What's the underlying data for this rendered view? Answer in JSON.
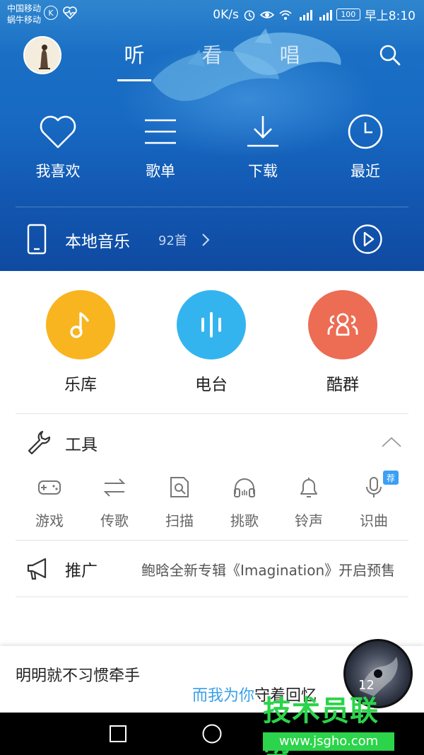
{
  "status_bar": {
    "carrier_1": "中国移动",
    "carrier_2": "蜗牛移动",
    "net_speed": "0K/s",
    "battery": "100",
    "time": "早上8:10"
  },
  "header": {
    "tabs": [
      {
        "label": "听",
        "active": true
      },
      {
        "label": "看",
        "active": false
      },
      {
        "label": "唱",
        "active": false
      }
    ]
  },
  "quick_actions": [
    {
      "label": "我喜欢",
      "icon": "heart-icon"
    },
    {
      "label": "歌单",
      "icon": "list-icon"
    },
    {
      "label": "下载",
      "icon": "download-icon"
    },
    {
      "label": "最近",
      "icon": "clock-icon"
    }
  ],
  "local_music": {
    "title": "本地音乐",
    "count": "92首"
  },
  "categories": [
    {
      "label": "乐库",
      "icon": "music-note-icon",
      "color": "#f8b520"
    },
    {
      "label": "电台",
      "icon": "radio-bars-icon",
      "color": "#34b4ef"
    },
    {
      "label": "酷群",
      "icon": "group-icon",
      "color": "#ec6c54"
    }
  ],
  "tools": {
    "title": "工具",
    "items": [
      {
        "label": "游戏",
        "icon": "gamepad-icon"
      },
      {
        "label": "传歌",
        "icon": "transfer-icon"
      },
      {
        "label": "扫描",
        "icon": "scan-icon"
      },
      {
        "label": "挑歌",
        "icon": "headphones-icon"
      },
      {
        "label": "铃声",
        "icon": "bell-icon"
      },
      {
        "label": "识曲",
        "icon": "mic-icon"
      }
    ],
    "badge": "荐"
  },
  "promo": {
    "title": "推广",
    "text": "鲍晗全新专辑《Imagination》开启预售"
  },
  "player": {
    "song": "明明就不习惯牵手",
    "lyric_highlight": "而我为你",
    "lyric_rest": "守着回忆",
    "disc_label": "12"
  },
  "watermark": {
    "title": "技术员联盟",
    "url": "www.jsgho.com"
  },
  "colors": {
    "hero": "#1769c2",
    "accent": "#39a0e6",
    "watermark": "#2bd44a"
  }
}
